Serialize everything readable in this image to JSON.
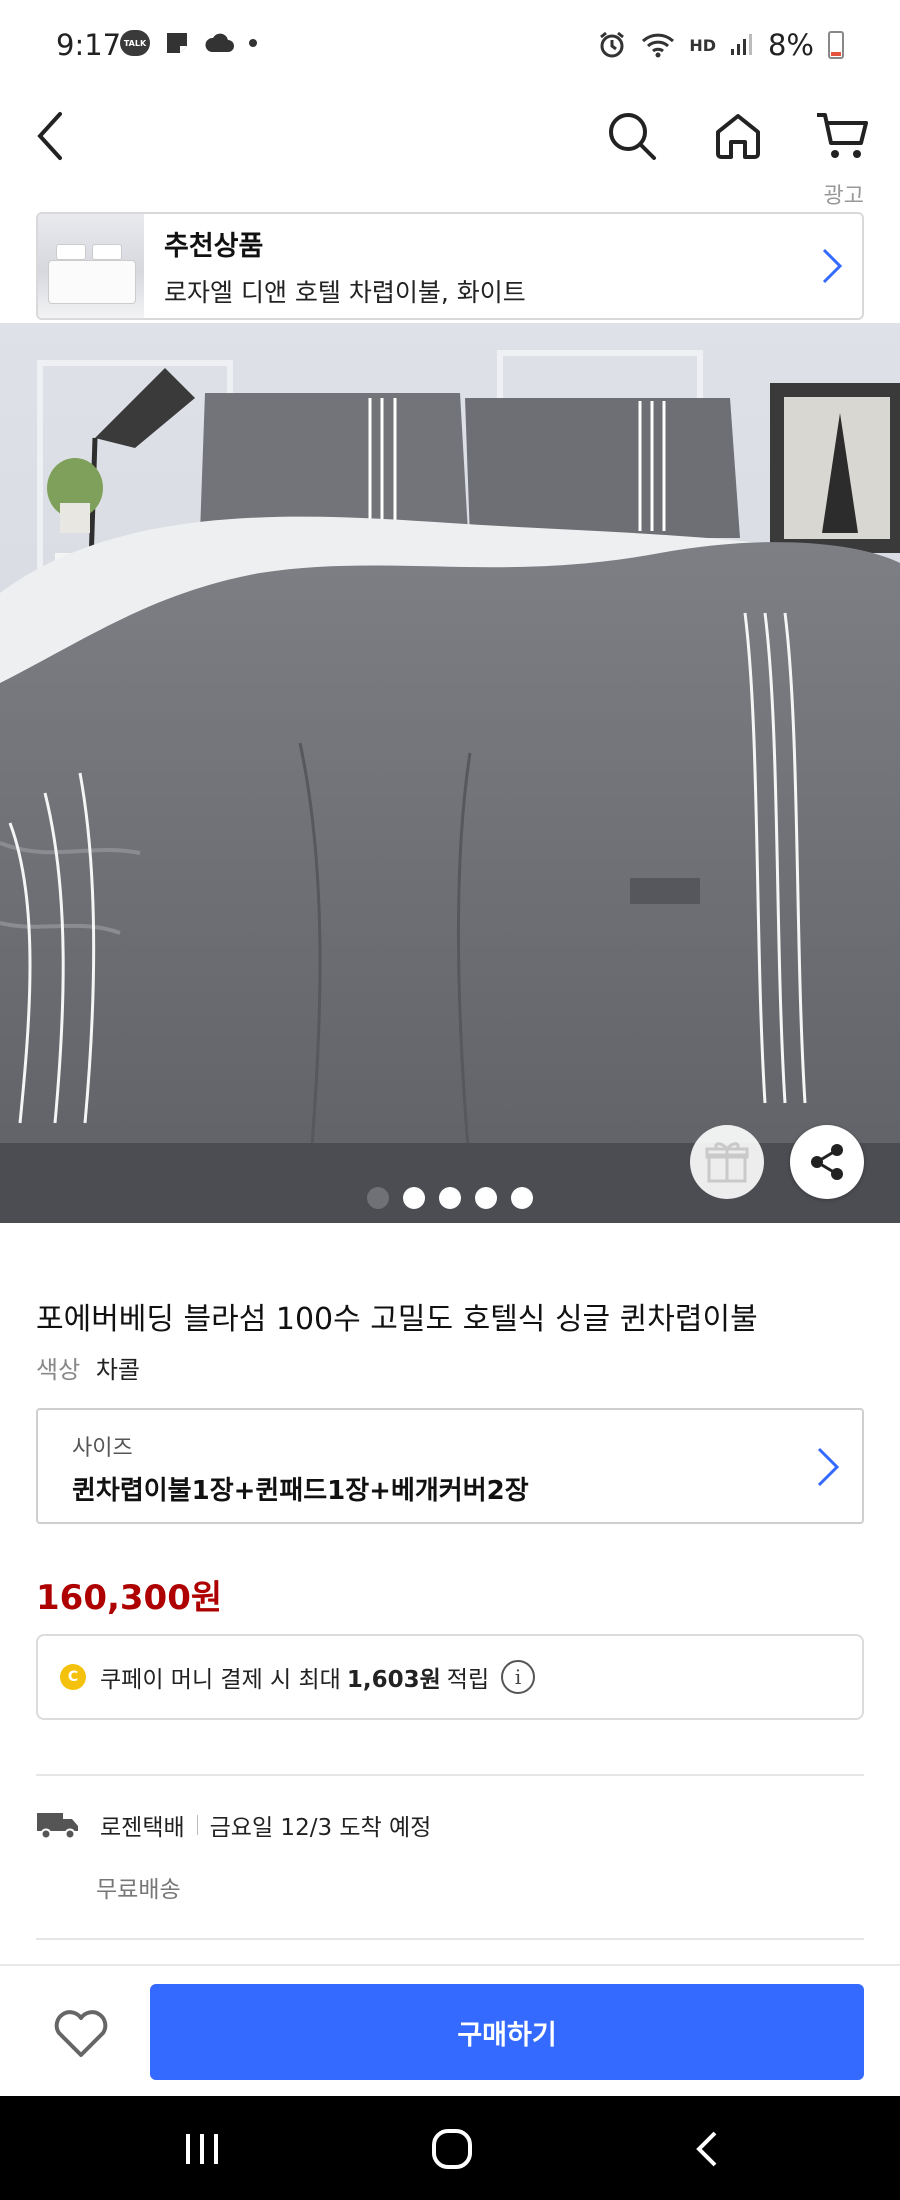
{
  "status_bar": {
    "time": "9:17",
    "talk_badge": "TALK",
    "battery_text": "8%",
    "network_label": "HD"
  },
  "nav": {
    "back_icon": "back-arrow-icon",
    "search_icon": "search-icon",
    "home_icon": "home-icon",
    "cart_icon": "cart-icon"
  },
  "ad": {
    "label": "광고",
    "title": "추천상품",
    "subtitle": "로자엘 디앤 호텔 차렵이불, 화이트"
  },
  "hero": {
    "image_desc_icon": "bedding-photo",
    "slide_count": 5,
    "active_slide": 1
  },
  "product": {
    "title": "포에버베딩 블라섬 100수 고밀도 호텔식 싱글 퀸차렵이불",
    "color_label": "색상",
    "color_value": "차콜",
    "size_label": "사이즈",
    "size_value": "퀸차렵이불1장+퀸패드1장+베개커버2장",
    "price": "160,300원"
  },
  "coupay": {
    "coin": "C",
    "prefix": "쿠페이 머니 결제 시 최대",
    "amount": "1,603원",
    "suffix": "적립",
    "info": "i"
  },
  "shipping": {
    "carrier": "로젠택배",
    "date": "금요일 12/3 도착 예정",
    "fee": "무료배송"
  },
  "buy_bar": {
    "buy_label": "구매하기"
  },
  "colors": {
    "price": "#ae0000",
    "buy_button": "#346aff",
    "chevron": "#346aff"
  }
}
